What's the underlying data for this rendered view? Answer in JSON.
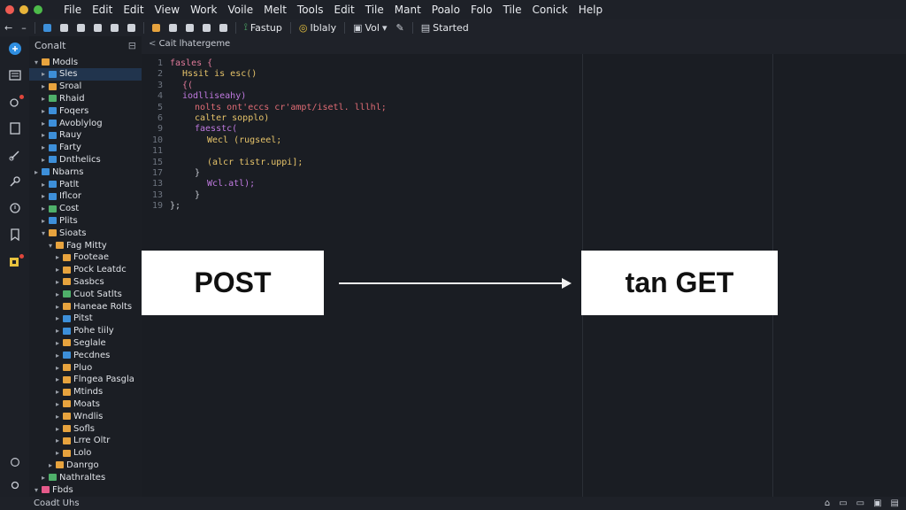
{
  "menubar": {
    "items": [
      "File",
      "Edit",
      "Edit",
      "View",
      "Work",
      "Voile",
      "Melt",
      "Tools",
      "Edit",
      "Tile",
      "Mant",
      "Poalo",
      "Folo",
      "Tile",
      "Conick",
      "Help"
    ]
  },
  "toolbar": {
    "fastup_label": "Fastup",
    "iblaly_label": "Iblaly",
    "view_label": "Vol",
    "started_label": "Started"
  },
  "activity": {
    "icons": [
      "files-icon",
      "explorer-icon",
      "extensions-icon",
      "book-icon",
      "link-icon",
      "key-icon",
      "debug-icon",
      "bookmark-icon",
      "git-icon"
    ],
    "bottom_icons": [
      "account-icon",
      "settings-icon"
    ]
  },
  "sidebar": {
    "title": "Conalt",
    "items": [
      {
        "label": "Modls",
        "depth": 0,
        "open": true,
        "color": "#e7a33e",
        "selected": false
      },
      {
        "label": "Sles",
        "depth": 1,
        "open": false,
        "color": "#3d8fd9",
        "selected": true
      },
      {
        "label": "Sroal",
        "depth": 1,
        "open": false,
        "color": "#e7a33e",
        "selected": false
      },
      {
        "label": "Rhaid",
        "depth": 1,
        "open": false,
        "color": "#4fb06a",
        "selected": false
      },
      {
        "label": "Foqers",
        "depth": 1,
        "open": false,
        "color": "#3d8fd9",
        "selected": false
      },
      {
        "label": "Avoblylog",
        "depth": 1,
        "open": false,
        "color": "#3d8fd9",
        "selected": false
      },
      {
        "label": "Rauy",
        "depth": 1,
        "open": false,
        "color": "#3d8fd9",
        "selected": false
      },
      {
        "label": "Farty",
        "depth": 1,
        "open": false,
        "color": "#3d8fd9",
        "selected": false
      },
      {
        "label": "Dnthelics",
        "depth": 1,
        "open": false,
        "color": "#3d8fd9",
        "selected": false
      },
      {
        "label": "Nbarns",
        "depth": 0,
        "open": false,
        "color": "#3d8fd9",
        "selected": false
      },
      {
        "label": "Patlt",
        "depth": 1,
        "open": false,
        "color": "#3d8fd9",
        "selected": false
      },
      {
        "label": "Iflcor",
        "depth": 1,
        "open": false,
        "color": "#3d8fd9",
        "selected": false
      },
      {
        "label": "Cost",
        "depth": 1,
        "open": false,
        "color": "#4fb06a",
        "selected": false
      },
      {
        "label": "Plits",
        "depth": 1,
        "open": false,
        "color": "#3d8fd9",
        "selected": false
      },
      {
        "label": "Sioats",
        "depth": 1,
        "open": true,
        "color": "#e7a33e",
        "selected": false
      },
      {
        "label": "Fag Mitty",
        "depth": 2,
        "open": true,
        "color": "#e7a33e",
        "selected": false
      },
      {
        "label": "Footeae",
        "depth": 3,
        "open": false,
        "color": "#e7a33e",
        "selected": false
      },
      {
        "label": "Pock Leatdc",
        "depth": 3,
        "open": false,
        "color": "#e7a33e",
        "selected": false
      },
      {
        "label": "Sasbcs",
        "depth": 3,
        "open": false,
        "color": "#e7a33e",
        "selected": false
      },
      {
        "label": "Cuot Satlts",
        "depth": 3,
        "open": false,
        "color": "#4fb06a",
        "selected": false
      },
      {
        "label": "Haneae Rolts",
        "depth": 3,
        "open": false,
        "color": "#e7a33e",
        "selected": false
      },
      {
        "label": "Pitst",
        "depth": 3,
        "open": false,
        "color": "#3d8fd9",
        "selected": false
      },
      {
        "label": "Pohe tiily",
        "depth": 3,
        "open": false,
        "color": "#3d8fd9",
        "selected": false
      },
      {
        "label": "Seglale",
        "depth": 3,
        "open": false,
        "color": "#e7a33e",
        "selected": false
      },
      {
        "label": "Pecdnes",
        "depth": 3,
        "open": false,
        "color": "#3d8fd9",
        "selected": false
      },
      {
        "label": "Pluo",
        "depth": 3,
        "open": false,
        "color": "#e7a33e",
        "selected": false
      },
      {
        "label": "Flngea Pasgla",
        "depth": 3,
        "open": false,
        "color": "#e7a33e",
        "selected": false
      },
      {
        "label": "Mtinds",
        "depth": 3,
        "open": false,
        "color": "#e7a33e",
        "selected": false
      },
      {
        "label": "Moats",
        "depth": 3,
        "open": false,
        "color": "#e7a33e",
        "selected": false
      },
      {
        "label": "Wndlis",
        "depth": 3,
        "open": false,
        "color": "#e7a33e",
        "selected": false
      },
      {
        "label": "Sofls",
        "depth": 3,
        "open": false,
        "color": "#e7a33e",
        "selected": false
      },
      {
        "label": "Lrre Oltr",
        "depth": 3,
        "open": false,
        "color": "#e7a33e",
        "selected": false
      },
      {
        "label": "Lolo",
        "depth": 3,
        "open": false,
        "color": "#e7a33e",
        "selected": false
      },
      {
        "label": "Danrgo",
        "depth": 2,
        "open": false,
        "color": "#e7a33e",
        "selected": false
      },
      {
        "label": "Nathraltes",
        "depth": 1,
        "open": false,
        "color": "#4fb06a",
        "selected": false
      },
      {
        "label": "Fbds",
        "depth": 0,
        "open": true,
        "color": "#e55a8a",
        "selected": false
      }
    ]
  },
  "editor": {
    "tab_label": "Cait lhatergeme",
    "code": [
      {
        "num": "1",
        "text": "fasles {",
        "color": "#e07a9a",
        "indent": 0
      },
      {
        "num": "2",
        "text": "Hssit is esc()",
        "color": "#e7c46a",
        "indent": 1
      },
      {
        "num": "3",
        "text": "{(",
        "color": "#e07a9a",
        "indent": 1
      },
      {
        "num": "4",
        "text": "iodlliseahy)",
        "color": "#c07ae0",
        "indent": 1
      },
      {
        "num": "5",
        "text": "nolts ont'eccs cr'ampt/isetl. lllhl;",
        "color": "#e06c75",
        "indent": 2
      },
      {
        "num": "6",
        "text": "calter sopplo)",
        "color": "#e7c46a",
        "indent": 2
      },
      {
        "num": "9",
        "text": "faesstc(",
        "color": "#c07ae0",
        "indent": 2
      },
      {
        "num": "10",
        "text": "Wecl (rugseel;",
        "color": "#e7c46a",
        "indent": 3
      },
      {
        "num": "11",
        "text": "",
        "color": "#c8ccd4",
        "indent": 3
      },
      {
        "num": "15",
        "text": "(alcr tistr.uppi];",
        "color": "#e7c46a",
        "indent": 3
      },
      {
        "num": "17",
        "text": "}",
        "color": "#c8ccd4",
        "indent": 2
      },
      {
        "num": "13",
        "text": "Wcl.atl);",
        "color": "#c07ae0",
        "indent": 3
      },
      {
        "num": "13",
        "text": "}",
        "color": "#c8ccd4",
        "indent": 2
      },
      {
        "num": "19",
        "text": "};",
        "color": "#c8ccd4",
        "indent": 0
      }
    ]
  },
  "diagram": {
    "left_label": "POST",
    "right_label": "tan GET"
  },
  "statusbar": {
    "left_label": "Coadt Uhs"
  }
}
